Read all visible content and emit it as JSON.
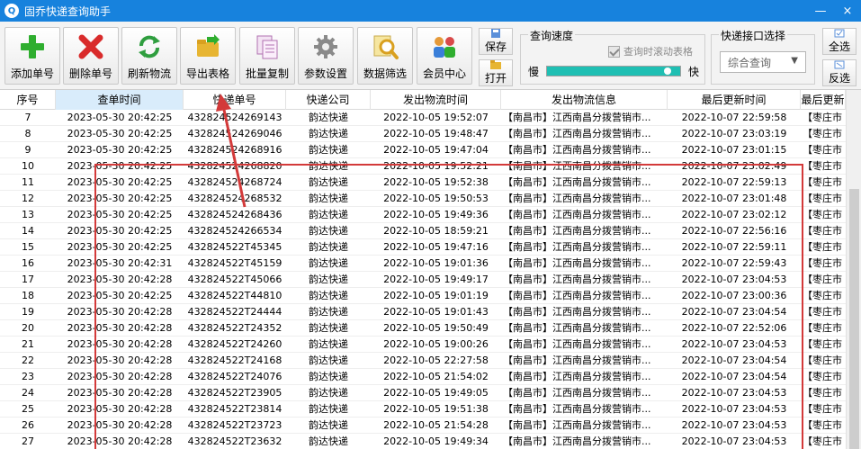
{
  "window": {
    "title": "固乔快递查询助手",
    "app_icon_glyph": "Q",
    "minimize_glyph": "—",
    "close_glyph": "×"
  },
  "toolbar": {
    "buttons": [
      {
        "label": "添加单号",
        "icon": "plus-icon"
      },
      {
        "label": "删除单号",
        "icon": "delete-x-icon"
      },
      {
        "label": "刷新物流",
        "icon": "refresh-icon"
      },
      {
        "label": "导出表格",
        "icon": "export-folder-icon"
      },
      {
        "label": "批量复制",
        "icon": "copy-icon"
      },
      {
        "label": "参数设置",
        "icon": "gear-icon"
      },
      {
        "label": "数据筛选",
        "icon": "filter-magnifier-icon"
      },
      {
        "label": "会员中心",
        "icon": "members-icon"
      }
    ],
    "save_label": "保存",
    "open_label": "打开",
    "select_all_label": "全选",
    "invert_label": "反选"
  },
  "speed": {
    "group_title": "查询速度",
    "scroll_checkbox_label": "查询时滚动表格",
    "scroll_checked": true,
    "slow_label": "慢",
    "fast_label": "快",
    "level": 0.93
  },
  "api": {
    "group_title": "快递接口选择",
    "selected": "综合查询"
  },
  "table": {
    "columns": [
      "序号",
      "查单时间",
      "快递单号",
      "快递公司",
      "发出物流时间",
      "发出物流信息",
      "最后更新时间",
      "最后更新"
    ],
    "sorted_column": 1,
    "rows": [
      [
        "7",
        "2023-05-30  20:42:25",
        "432824524269143",
        "韵达快递",
        "2022-10-05  19:52:07",
        "【南昌市】江西南昌分拨营销市...",
        "2022-10-07  22:59:58",
        "【枣庄市"
      ],
      [
        "8",
        "2023-05-30  20:42:25",
        "432824524269046",
        "韵达快递",
        "2022-10-05  19:48:47",
        "【南昌市】江西南昌分拨营销市...",
        "2022-10-07  23:03:19",
        "【枣庄市"
      ],
      [
        "9",
        "2023-05-30  20:42:25",
        "432824524268916",
        "韵达快递",
        "2022-10-05  19:47:04",
        "【南昌市】江西南昌分拨营销市...",
        "2022-10-07  23:01:15",
        "【枣庄市"
      ],
      [
        "10",
        "2023-05-30  20:42:25",
        "432824524268820",
        "韵达快递",
        "2022-10-05  19:52:21",
        "【南昌市】江西南昌分拨营销市...",
        "2022-10-07  23:02:49",
        "【枣庄市"
      ],
      [
        "11",
        "2023-05-30  20:42:25",
        "432824524268724",
        "韵达快递",
        "2022-10-05  19:52:38",
        "【南昌市】江西南昌分拨营销市...",
        "2022-10-07  22:59:13",
        "【枣庄市"
      ],
      [
        "12",
        "2023-05-30  20:42:25",
        "432824524268532",
        "韵达快递",
        "2022-10-05  19:50:53",
        "【南昌市】江西南昌分拨营销市...",
        "2022-10-07  23:01:48",
        "【枣庄市"
      ],
      [
        "13",
        "2023-05-30  20:42:25",
        "432824524268436",
        "韵达快递",
        "2022-10-05  19:49:36",
        "【南昌市】江西南昌分拨营销市...",
        "2022-10-07  23:02:12",
        "【枣庄市"
      ],
      [
        "14",
        "2023-05-30  20:42:25",
        "432824524266534",
        "韵达快递",
        "2022-10-05  18:59:21",
        "【南昌市】江西南昌分拨营销市...",
        "2022-10-07  22:56:16",
        "【枣庄市"
      ],
      [
        "15",
        "2023-05-30  20:42:25",
        "432824522T45345",
        "韵达快递",
        "2022-10-05  19:47:16",
        "【南昌市】江西南昌分拨营销市...",
        "2022-10-07  22:59:11",
        "【枣庄市"
      ],
      [
        "16",
        "2023-05-30  20:42:31",
        "432824522T45159",
        "韵达快递",
        "2022-10-05  19:01:36",
        "【南昌市】江西南昌分拨营销市...",
        "2022-10-07  22:59:43",
        "【枣庄市"
      ],
      [
        "17",
        "2023-05-30  20:42:28",
        "432824522T45066",
        "韵达快递",
        "2022-10-05  19:49:17",
        "【南昌市】江西南昌分拨营销市...",
        "2022-10-07  23:04:53",
        "【枣庄市"
      ],
      [
        "18",
        "2023-05-30  20:42:25",
        "432824522T44810",
        "韵达快递",
        "2022-10-05  19:01:19",
        "【南昌市】江西南昌分拨营销市...",
        "2022-10-07  23:00:36",
        "【枣庄市"
      ],
      [
        "19",
        "2023-05-30  20:42:28",
        "432824522T24444",
        "韵达快递",
        "2022-10-05  19:01:43",
        "【南昌市】江西南昌分拨营销市...",
        "2022-10-07  23:04:54",
        "【枣庄市"
      ],
      [
        "20",
        "2023-05-30  20:42:28",
        "432824522T24352",
        "韵达快递",
        "2022-10-05  19:50:49",
        "【南昌市】江西南昌分拨营销市...",
        "2022-10-07  22:52:06",
        "【枣庄市"
      ],
      [
        "21",
        "2023-05-30  20:42:28",
        "432824522T24260",
        "韵达快递",
        "2022-10-05  19:00:26",
        "【南昌市】江西南昌分拨营销市...",
        "2022-10-07  23:04:53",
        "【枣庄市"
      ],
      [
        "22",
        "2023-05-30  20:42:28",
        "432824522T24168",
        "韵达快递",
        "2022-10-05  22:27:58",
        "【南昌市】江西南昌分拨营销市...",
        "2022-10-07  23:04:54",
        "【枣庄市"
      ],
      [
        "23",
        "2023-05-30  20:42:28",
        "432824522T24076",
        "韵达快递",
        "2022-10-05  21:54:02",
        "【南昌市】江西南昌分拨营销市...",
        "2022-10-07  23:04:54",
        "【枣庄市"
      ],
      [
        "24",
        "2023-05-30  20:42:28",
        "432824522T23905",
        "韵达快递",
        "2022-10-05  19:49:05",
        "【南昌市】江西南昌分拨营销市...",
        "2022-10-07  23:04:53",
        "【枣庄市"
      ],
      [
        "25",
        "2023-05-30  20:42:28",
        "432824522T23814",
        "韵达快递",
        "2022-10-05  19:51:38",
        "【南昌市】江西南昌分拨营销市...",
        "2022-10-07  23:04:53",
        "【枣庄市"
      ],
      [
        "26",
        "2023-05-30  20:42:28",
        "432824522T23723",
        "韵达快递",
        "2022-10-05  21:54:28",
        "【南昌市】江西南昌分拨营销市...",
        "2022-10-07  23:04:53",
        "【枣庄市"
      ],
      [
        "27",
        "2023-05-30  20:42:28",
        "432824522T23632",
        "韵达快递",
        "2022-10-05  19:49:34",
        "【南昌市】江西南昌分拨营销市...",
        "2022-10-07  23:04:53",
        "【枣庄市"
      ]
    ]
  },
  "colors": {
    "titlebar": "#1782dd",
    "annotation": "#d33a3a",
    "slider": "#1fbfb3",
    "sorted_header": "#d9ecfb"
  }
}
